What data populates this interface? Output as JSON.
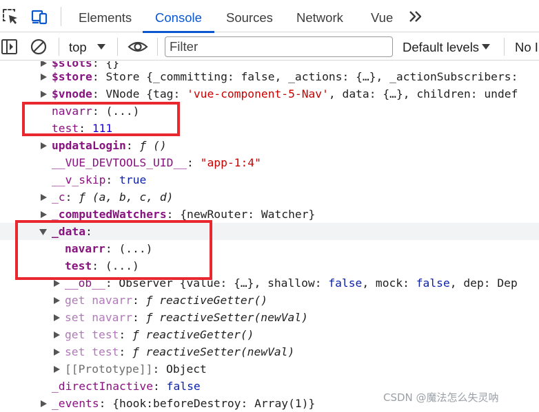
{
  "tabs": {
    "items": [
      "Elements",
      "Console",
      "Sources",
      "Network",
      "Vue"
    ],
    "active": "Console"
  },
  "toolbar": {
    "context": "top",
    "filter_placeholder": "Filter",
    "levels": "Default levels",
    "issues": "No I"
  },
  "icons": {
    "inspect": "inspect-element-icon",
    "device": "device-toggle-icon",
    "more_tabs": "chevron-double-right-icon",
    "sidebar": "sidebar-toggle-icon",
    "clear": "clear-console-icon",
    "live_expression": "eye-icon",
    "expand": "triangle-right-icon",
    "collapse": "triangle-down-icon"
  },
  "colors": {
    "accent": "#0b57d0",
    "key": "#881280",
    "string": "#c80000",
    "keyword": "#0d22aa",
    "number": "#1c00cf",
    "annotation": "#e8282e"
  },
  "tree": {
    "slots": {
      "key": "$slots",
      "value": "{}"
    },
    "store": {
      "key": "$store",
      "value": "Store {_committing: false, _actions: {…}, _actionSubscribers:"
    },
    "vnode": {
      "key": "$vnode",
      "value": "VNode {tag: 'vue-component-5-Nav', data: {…}, children: undef"
    },
    "navarr": {
      "key": "navarr",
      "value": "(...)"
    },
    "test": {
      "key": "test",
      "value": "111"
    },
    "updataLogin": {
      "key": "updataLogin",
      "value": "ƒ ()"
    },
    "devtools_uid": {
      "key": "__VUE_DEVTOOLS_UID__",
      "value": "\"app-1:4\""
    },
    "v_skip": {
      "key": "__v_skip",
      "value": "true"
    },
    "c": {
      "key": "_c",
      "value": "ƒ (a, b, c, d)"
    },
    "computedWatchers": {
      "key": "_computedWatchers",
      "value": "{newRouter: Watcher}"
    },
    "data": {
      "key": "_data",
      "value": ""
    },
    "data_navarr": {
      "key": "navarr",
      "value": "(...)"
    },
    "data_test": {
      "key": "test",
      "value": "(...)"
    },
    "ob": {
      "key": "__ob__",
      "value": "Observer {value: {…}, shallow: false, mock: false, dep: Dep"
    },
    "get_navarr": {
      "key": "get navarr",
      "value": "reactiveGetter()"
    },
    "set_navarr": {
      "key": "set navarr",
      "value": "reactiveSetter(newVal)"
    },
    "get_test": {
      "key": "get test",
      "value": "reactiveGetter()"
    },
    "set_test": {
      "key": "set test",
      "value": "reactiveSetter(newVal)"
    },
    "prototype": {
      "key": "[[Prototype]]",
      "value": "Object"
    },
    "directInactive": {
      "key": "_directInactive",
      "value": "false"
    },
    "events": {
      "key": "_events",
      "value": "{hook:beforeDestroy: Array(1)}"
    }
  },
  "watermark": "CSDN @魔法怎么失灵呐"
}
